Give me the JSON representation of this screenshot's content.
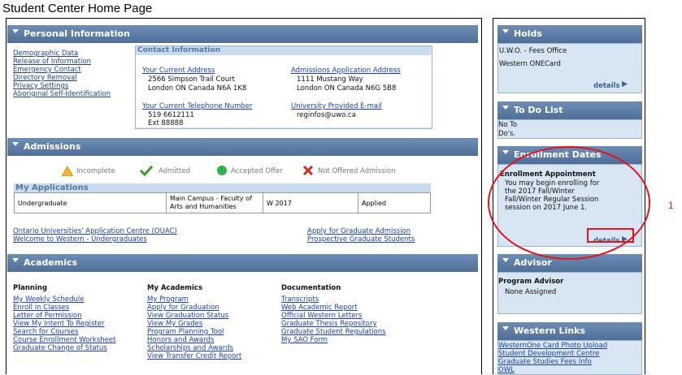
{
  "page_title": "Student Center Home Page",
  "personal": {
    "header": "Personal Information",
    "links": [
      "Demographic Data",
      "Release of Information",
      "Emergency Contact",
      "Directory Removal",
      "Privacy Settings",
      "Aboriginal Self-Identification"
    ],
    "contact": {
      "header": "Contact Information",
      "current_address_label": "Your Current Address",
      "current_address_lines": [
        "2566 Simpson Trail Court",
        "London ON Canada N6A 1K8"
      ],
      "phone_label": "Your Current Telephone Number",
      "phone_lines": [
        "519 6612111",
        "Ext 88888"
      ],
      "admissions_address_label": "Admissions Application Address",
      "admissions_address_lines": [
        "1111 Mustang Way",
        "London ON Canada N6G 5B8"
      ],
      "email_label": "University Provided E-mail",
      "email_value": "reginfos@uwo.ca"
    }
  },
  "admissions": {
    "header": "Admissions",
    "legend": [
      {
        "label": "Incomplete",
        "icon": "warning-icon",
        "color": "#f2b233"
      },
      {
        "label": "Admitted",
        "icon": "checkmark-icon",
        "color": "#3c9b2b"
      },
      {
        "label": "Accepted Offer",
        "icon": "circle-icon",
        "color": "#2fb24a"
      },
      {
        "label": "Not Offered Admission",
        "icon": "x-icon",
        "color": "#d8281d"
      }
    ],
    "applications_header": "My Applications",
    "rows": [
      {
        "career": "Undergraduate",
        "program": "Main Campus - Faculty of Arts and Humanities",
        "term": "W 2017",
        "status": "Applied"
      }
    ],
    "links_left": [
      "Ontario Universities' Application Centre (OUAC)",
      "Welcome to Western - Undergraduates"
    ],
    "links_right": [
      "Apply for Graduate Admission",
      "Prospective Graduate Students"
    ]
  },
  "academics": {
    "header": "Academics",
    "planning": {
      "title": "Planning",
      "links": [
        "My Weekly Schedule",
        "Enroll in Classes",
        "Letter of Permission",
        "View My Intent To Register",
        "Search for Courses",
        "Course Enrollment Worksheet",
        "Graduate Change of Status"
      ]
    },
    "my_academics": {
      "title": "My Academics",
      "links": [
        "My Program",
        "Apply for Graduation",
        "View Graduation Status",
        "View My Grades",
        "Program Planning Tool",
        "Honors and Awards",
        "Scholarships and Awards",
        "View Transfer Credit Report"
      ]
    },
    "documentation": {
      "title": "Documentation",
      "links": [
        "Transcripts",
        "Web Academic Report",
        "Official Western Letters",
        "Graduate Thesis Repository",
        "Graduate Student Regulations",
        "My SAO Form"
      ]
    }
  },
  "holds": {
    "header": "Holds",
    "items": [
      "U.W.O. - Fees Office",
      "Western ONECard"
    ],
    "details_label": "details"
  },
  "todo": {
    "header": "To Do List",
    "text_line1": "No To",
    "text_line2": "Do's."
  },
  "enrollment_dates": {
    "header": "Enrollment Dates",
    "title": "Enrollment Appointment",
    "lines": [
      "You may begin enrolling for",
      "the 2017 Fall/Winter",
      "Fall/Winter Regular Session",
      "session on 2017 June 1."
    ],
    "details_label": "details"
  },
  "advisor": {
    "header": "Advisor",
    "title": "Program Advisor",
    "value": "None Assigned"
  },
  "western_links": {
    "header": "Western Links",
    "links": [
      "WesternOne Card Photo Upload",
      "Student Development Centre",
      "Graduate Studies Fees Info",
      "OWL"
    ]
  },
  "annotation_number": "1",
  "colors": {
    "header_blue": "#5e7da4",
    "link_blue": "#1d3fa8",
    "highlight_red": "#e0141e",
    "panel_blue": "#d8e6f3"
  }
}
